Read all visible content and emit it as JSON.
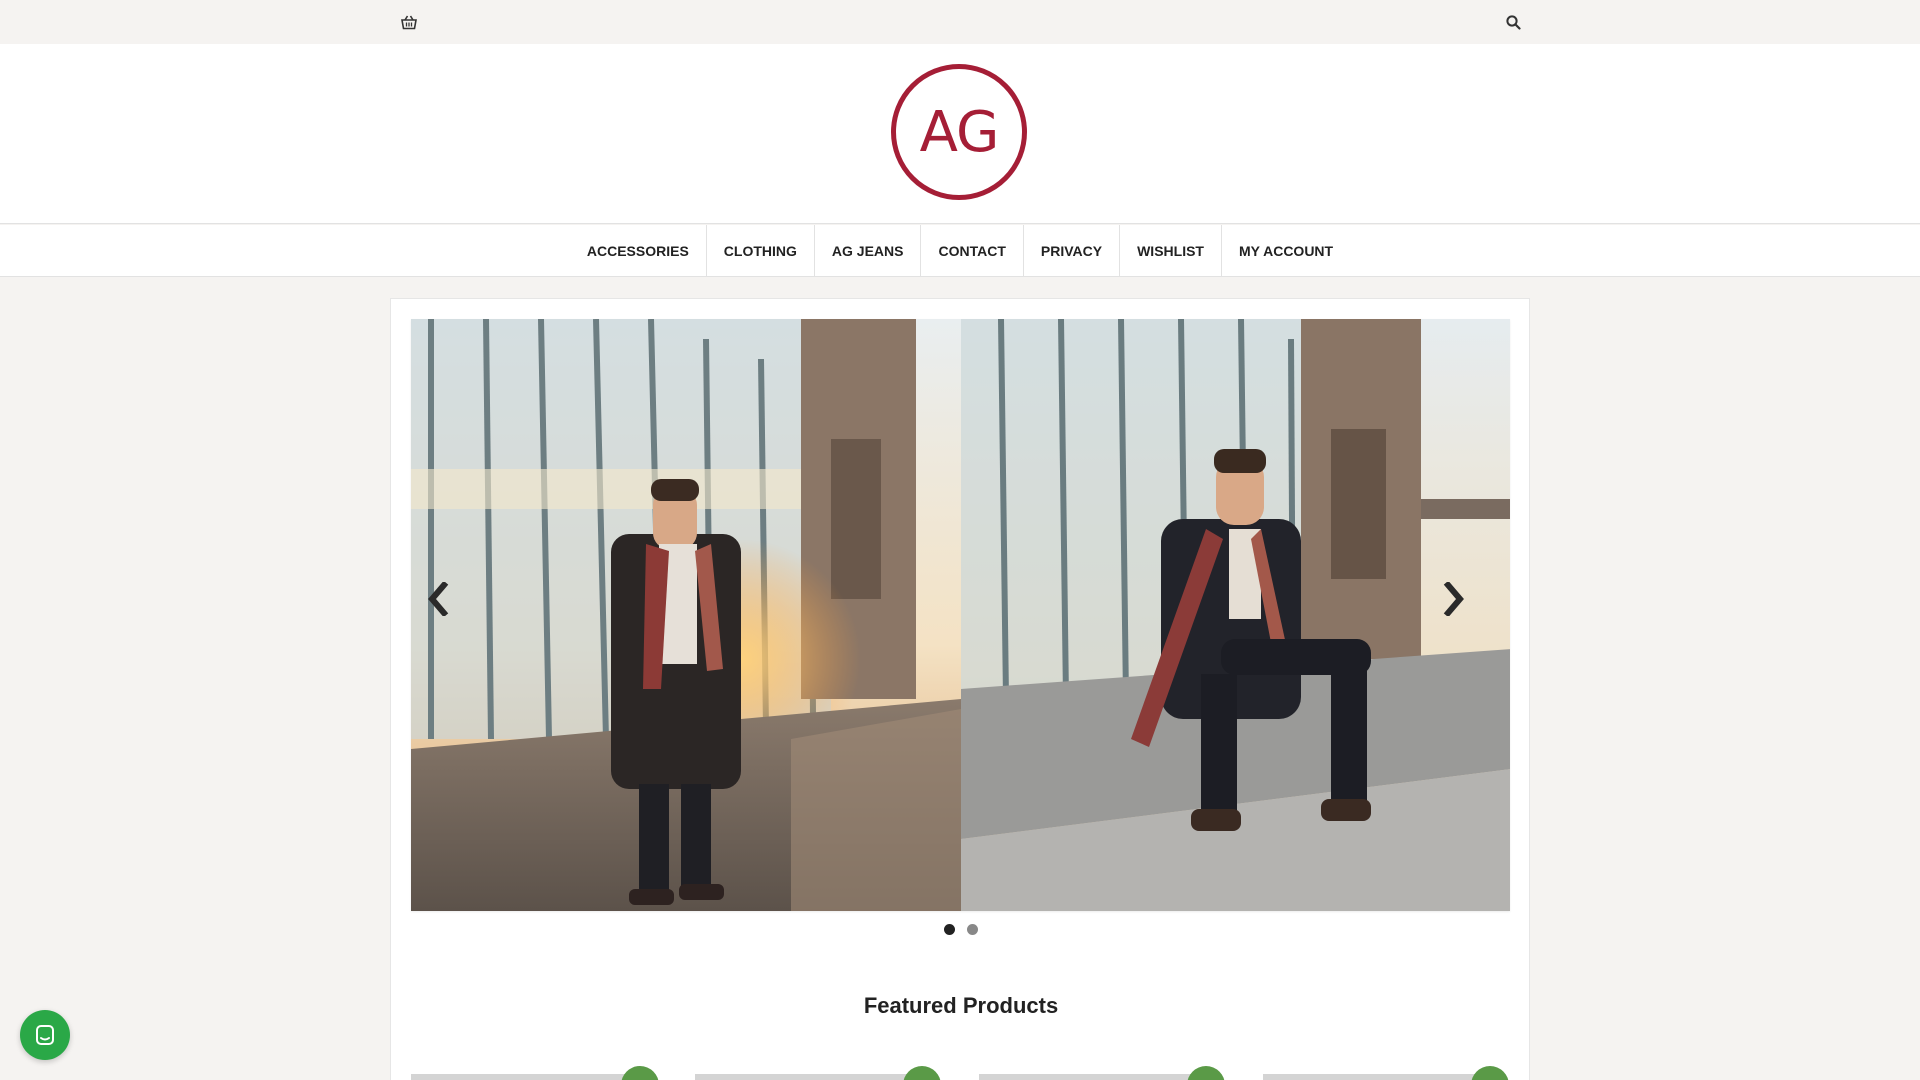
{
  "topbar": {
    "cart_icon": "basket-icon",
    "search_icon": "search-icon"
  },
  "brand": {
    "logo_text": "AG",
    "logo_color": "#a51e36"
  },
  "nav": {
    "items": [
      {
        "label": "ACCESSORIES"
      },
      {
        "label": "CLOTHING"
      },
      {
        "label": "AG JEANS"
      },
      {
        "label": "CONTACT"
      },
      {
        "label": "PRIVACY"
      },
      {
        "label": "WISHLIST"
      },
      {
        "label": "MY ACCOUNT"
      }
    ]
  },
  "slider": {
    "prev_icon": "chevron-left-icon",
    "next_icon": "chevron-right-icon",
    "slides": [
      {
        "image": "man-standing-scarf-photo"
      },
      {
        "image": "man-sitting-scarf-photo"
      }
    ],
    "dots": 2,
    "active_dot": 0
  },
  "featured": {
    "title": "Featured Products",
    "badge_color": "#5a9a47"
  },
  "chat": {
    "icon": "chat-icon",
    "color": "#2aa847"
  }
}
